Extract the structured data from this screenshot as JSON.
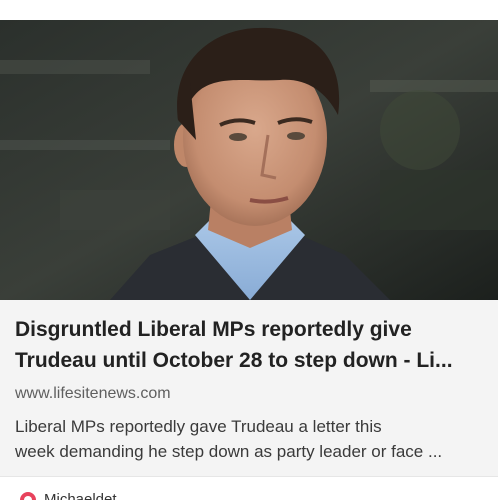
{
  "article": {
    "image_icon": "news-photo-image",
    "headline_line1": "Disgruntled Liberal MPs reportedly give",
    "headline_line2": "Trudeau until October 28 to step down - Li...",
    "domain": "www.lifesitenews.com",
    "description_line1": "Liberal MPs reportedly gave Trudeau a letter this",
    "description_line2": "week demanding he step down as party leader or face ..."
  },
  "source": {
    "icon": "source-avatar-icon",
    "name": "Michaeldet"
  },
  "colors": {
    "card_background": "#f4f4f4",
    "headline": "#222222",
    "domain_text": "#5f5f5f",
    "source_icon": "#e8425c"
  }
}
